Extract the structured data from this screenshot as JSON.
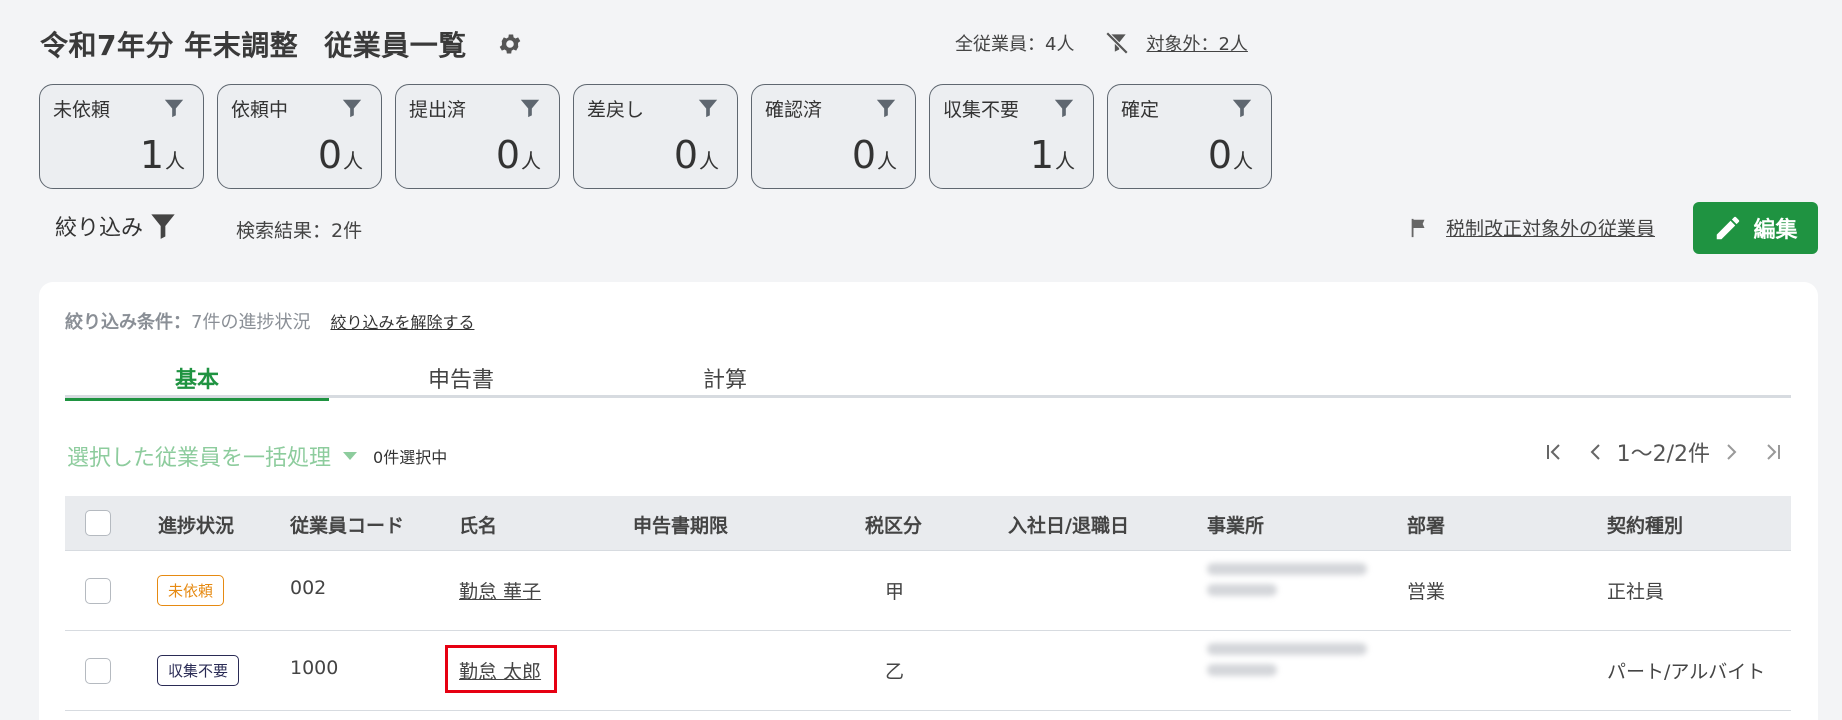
{
  "header": {
    "title_part1": "令和7年分 年末調整",
    "title_part2": "従業員一覧",
    "total_employees": "全従業員：4人",
    "excluded_link": "対象外：2人"
  },
  "status_cards": [
    {
      "label": "未依頼",
      "count": "1",
      "unit": "人"
    },
    {
      "label": "依頼中",
      "count": "0",
      "unit": "人"
    },
    {
      "label": "提出済",
      "count": "0",
      "unit": "人"
    },
    {
      "label": "差戻し",
      "count": "0",
      "unit": "人"
    },
    {
      "label": "確認済",
      "count": "0",
      "unit": "人"
    },
    {
      "label": "収集不要",
      "count": "1",
      "unit": "人"
    },
    {
      "label": "確定",
      "count": "0",
      "unit": "人"
    }
  ],
  "filter": {
    "label": "絞り込み",
    "search_result": "検索結果：2件"
  },
  "actions": {
    "exempt_link": "税制改正対象外の従業員",
    "edit_button": "編集"
  },
  "panel": {
    "condition_label": "絞り込み条件：",
    "condition_value": "7件の進捗状況",
    "clear_link": "絞り込みを解除する",
    "tabs": [
      "基本",
      "申告書",
      "計算"
    ],
    "bulk_action": "選択した従業員を一括処理",
    "selected_count": "0件選択中",
    "pager_text": "1〜2/2件"
  },
  "table": {
    "columns": [
      "進捗状況",
      "従業員コード",
      "氏名",
      "申告書期限",
      "税区分",
      "入社日/退職日",
      "事業所",
      "部署",
      "契約種別"
    ],
    "rows": [
      {
        "status": "未依頼",
        "code": "002",
        "name": "勤怠 華子",
        "deadline": "",
        "tax": "甲",
        "dates": "",
        "dept": "営業",
        "contract": "正社員"
      },
      {
        "status": "収集不要",
        "code": "1000",
        "name": "勤怠 太郎",
        "deadline": "",
        "tax": "乙",
        "dates": "",
        "dept": "",
        "contract": "パート/アルバイト"
      }
    ]
  },
  "colors": {
    "brand_green": "#1f9341",
    "status_unrequested": "#e68a12",
    "status_not_required": "#2a2b55",
    "highlight_red": "#e60012"
  }
}
